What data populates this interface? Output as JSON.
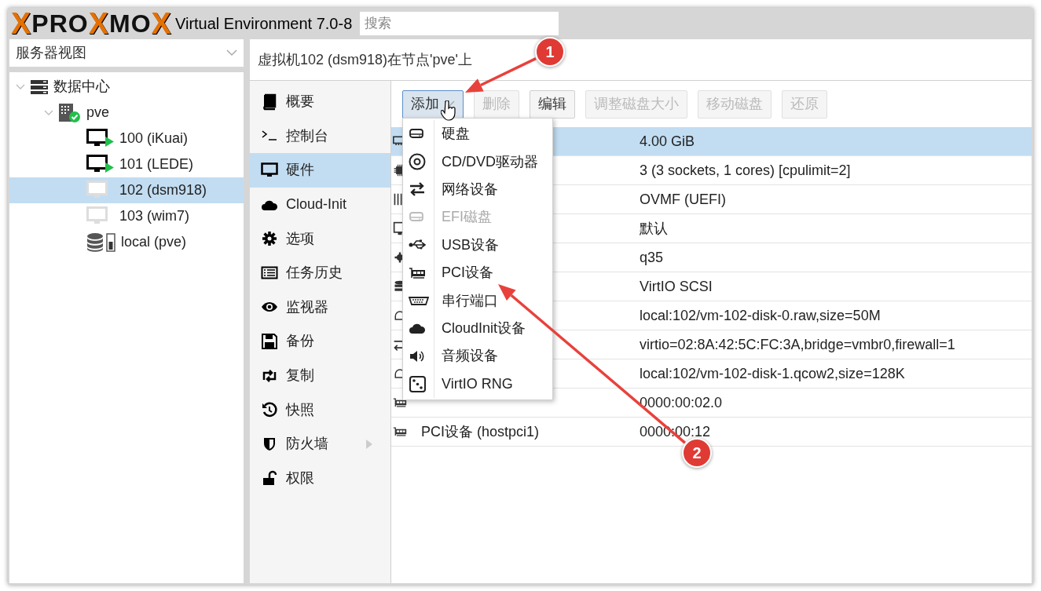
{
  "header": {
    "logo": [
      {
        "text": "X",
        "accent": true
      },
      {
        "text": "PRO",
        "accent": false
      },
      {
        "text": "X",
        "accent": true
      },
      {
        "text": "MO",
        "accent": false
      },
      {
        "text": "X",
        "accent": true
      }
    ],
    "version": "Virtual Environment 7.0-8",
    "search": {
      "placeholder": "搜索"
    }
  },
  "view_selector": {
    "value": "服务器视图"
  },
  "tree": [
    {
      "label": "数据中心",
      "kind": "datacenter",
      "expanded": true,
      "selected": false,
      "children": [
        {
          "label": "pve",
          "kind": "node",
          "expanded": true,
          "selected": false,
          "children": [
            {
              "label": "100 (iKuai)",
              "kind": "vm",
              "running": true,
              "selected": false
            },
            {
              "label": "101 (LEDE)",
              "kind": "vm",
              "running": true,
              "selected": false
            },
            {
              "label": "102 (dsm918)",
              "kind": "vm",
              "running": false,
              "selected": true
            },
            {
              "label": "103 (wim7)",
              "kind": "vm",
              "running": false,
              "selected": false
            },
            {
              "label": "local (pve)",
              "kind": "storage",
              "selected": false
            }
          ]
        }
      ]
    }
  ],
  "panel_title": "虚拟机102 (dsm918)在节点'pve'上",
  "nav": [
    {
      "label": "概要",
      "kind": "book",
      "selected": false
    },
    {
      "label": "控制台",
      "kind": "terminal",
      "selected": false
    },
    {
      "label": "硬件",
      "kind": "monitor",
      "selected": true
    },
    {
      "label": "Cloud-Init",
      "kind": "cloud",
      "selected": false
    },
    {
      "label": "选项",
      "kind": "gear",
      "selected": false
    },
    {
      "label": "任务历史",
      "kind": "list",
      "selected": false
    },
    {
      "label": "监视器",
      "kind": "eye",
      "selected": false
    },
    {
      "label": "备份",
      "kind": "floppy",
      "selected": false
    },
    {
      "label": "复制",
      "kind": "retweet",
      "selected": false
    },
    {
      "label": "快照",
      "kind": "history",
      "selected": false
    },
    {
      "label": "防火墙",
      "kind": "shield",
      "selected": false,
      "has_submenu": true
    },
    {
      "label": "权限",
      "kind": "unlock",
      "selected": false
    }
  ],
  "toolbar": [
    {
      "label": "添加",
      "disabled": false,
      "pressed": true,
      "dropdown": true
    },
    {
      "label": "删除",
      "disabled": true,
      "pressed": false
    },
    {
      "label": "编辑",
      "disabled": false,
      "pressed": false
    },
    {
      "label": "调整磁盘大小",
      "disabled": true,
      "pressed": false
    },
    {
      "label": "移动磁盘",
      "disabled": true,
      "pressed": false
    },
    {
      "label": "还原",
      "disabled": true,
      "pressed": false
    }
  ],
  "table": {
    "rows": [
      {
        "kind": "memory",
        "value": "4.00 GiB",
        "selected": true
      },
      {
        "kind": "cpu",
        "value": "3 (3 sockets, 1 cores) [cpulimit=2]",
        "selected": false
      },
      {
        "kind": "bios",
        "value": "OVMF (UEFI)",
        "selected": false
      },
      {
        "kind": "display",
        "value": "默认",
        "selected": false
      },
      {
        "kind": "gear",
        "value": "q35",
        "selected": false
      },
      {
        "kind": "scsi",
        "value": "VirtIO SCSI",
        "selected": false
      },
      {
        "kind": "disk",
        "value": "local:102/vm-102-disk-0.raw,size=50M",
        "selected": false
      },
      {
        "kind": "net",
        "value": "virtio=02:8A:42:5C:FC:3A,bridge=vmbr0,firewall=1",
        "selected": false
      },
      {
        "kind": "disk",
        "value": "local:102/vm-102-disk-1.qcow2,size=128K",
        "selected": false
      },
      {
        "kind": "pci",
        "value": "0000:00:02.0",
        "selected": false
      },
      {
        "kind": "pci",
        "name": "PCI设备 (hostpci1)",
        "value": "0000:00:12",
        "selected": false
      }
    ]
  },
  "add_menu": [
    {
      "label": "硬盘",
      "kind": "hdd",
      "disabled": false
    },
    {
      "label": "CD/DVD驱动器",
      "kind": "cdrom",
      "disabled": false
    },
    {
      "label": "网络设备",
      "kind": "net",
      "disabled": false
    },
    {
      "label": "EFI磁盘",
      "kind": "hdd",
      "disabled": true
    },
    {
      "label": "USB设备",
      "kind": "usb",
      "disabled": false
    },
    {
      "label": "PCI设备",
      "kind": "pci",
      "disabled": false
    },
    {
      "label": "串行端口",
      "kind": "serial",
      "disabled": false
    },
    {
      "label": "CloudInit设备",
      "kind": "cloud",
      "disabled": false
    },
    {
      "label": "音频设备",
      "kind": "audio",
      "disabled": false
    },
    {
      "label": "VirtIO RNG",
      "kind": "dice",
      "disabled": false
    }
  ],
  "annotations": [
    {
      "label": "1"
    },
    {
      "label": "2"
    }
  ]
}
